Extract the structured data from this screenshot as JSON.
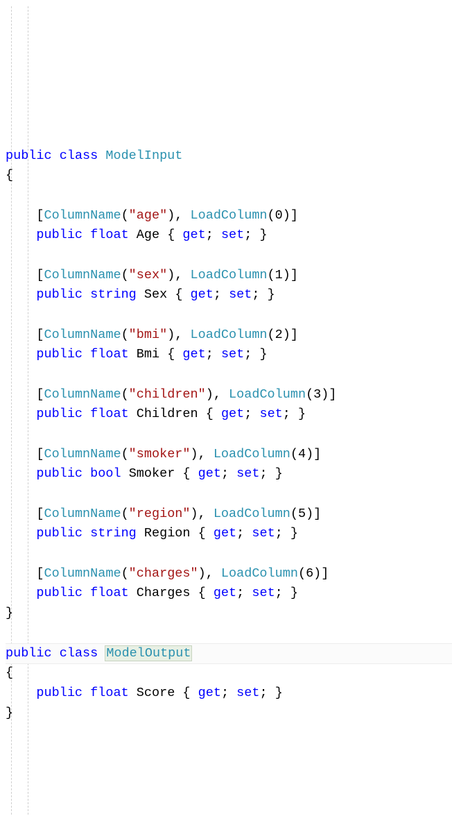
{
  "kw": {
    "public": "public",
    "class": "class",
    "float": "float",
    "string": "string",
    "bool": "bool",
    "get": "get",
    "set": "set"
  },
  "types": {
    "columnname": "ColumnName",
    "loadcolumn": "LoadColumn"
  },
  "class1": {
    "name": "ModelInput",
    "props": [
      {
        "col": "age",
        "idx": "0",
        "type": "float",
        "name": "Age"
      },
      {
        "col": "sex",
        "idx": "1",
        "type": "string",
        "name": "Sex"
      },
      {
        "col": "bmi",
        "idx": "2",
        "type": "float",
        "name": "Bmi"
      },
      {
        "col": "children",
        "idx": "3",
        "type": "float",
        "name": "Children"
      },
      {
        "col": "smoker",
        "idx": "4",
        "type": "bool",
        "name": "Smoker"
      },
      {
        "col": "region",
        "idx": "5",
        "type": "string",
        "name": "Region"
      },
      {
        "col": "charges",
        "idx": "6",
        "type": "float",
        "name": "Charges"
      }
    ]
  },
  "class2": {
    "name": "ModelOutput",
    "prop": {
      "type": "float",
      "name": "Score"
    }
  },
  "br": {
    "ob": "{",
    "cb": "}"
  }
}
